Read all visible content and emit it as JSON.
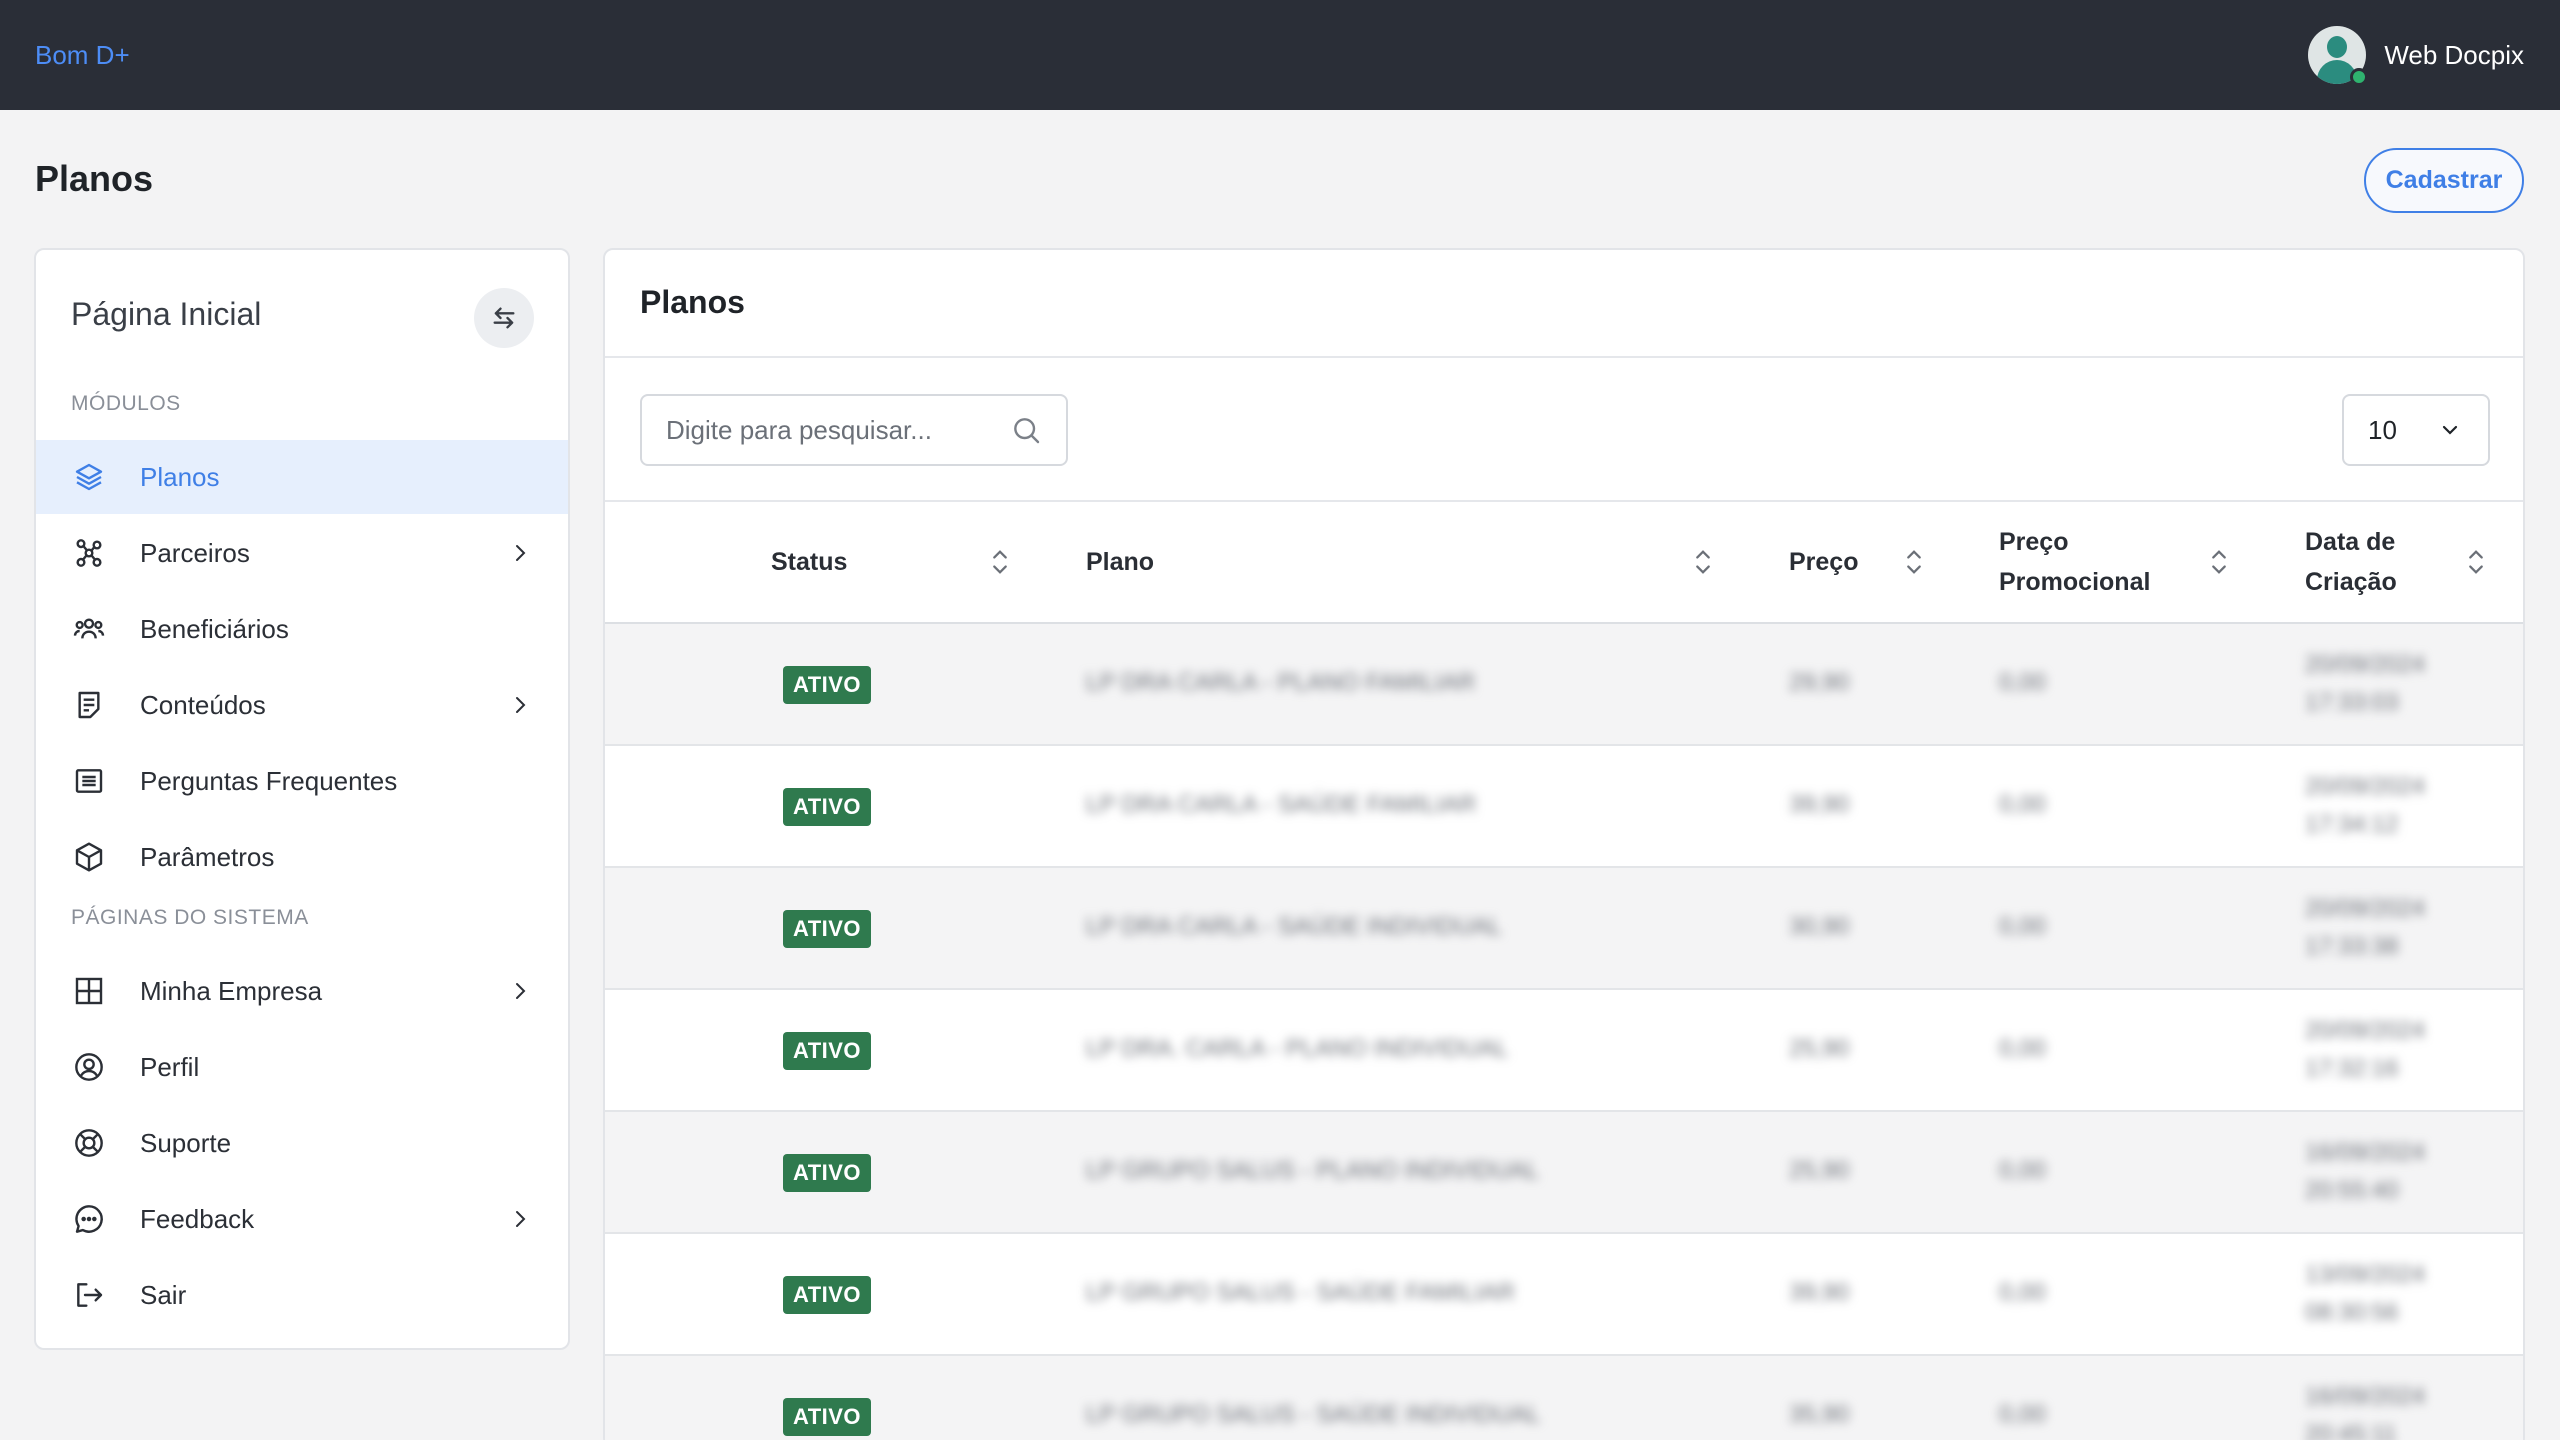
{
  "topbar": {
    "brand": "Bom D+",
    "user_name": "Web Docpix"
  },
  "header": {
    "title": "Planos",
    "cadastrar_label": "Cadastrar"
  },
  "sidebar": {
    "title": "Página Inicial",
    "section_modules": "MÓDULOS",
    "section_system": "PÁGINAS DO SISTEMA",
    "items": [
      {
        "label": "Planos",
        "icon": "layers-icon",
        "active": true
      },
      {
        "label": "Parceiros",
        "icon": "network-icon",
        "has_submenu": true
      },
      {
        "label": "Beneficiários",
        "icon": "users-icon"
      },
      {
        "label": "Conteúdos",
        "icon": "document-icon",
        "has_submenu": true
      },
      {
        "label": "Perguntas Frequentes",
        "icon": "list-icon"
      },
      {
        "label": "Parâmetros",
        "icon": "cube-icon"
      },
      {
        "label": "Minha Empresa",
        "icon": "grid-icon",
        "has_submenu": true
      },
      {
        "label": "Perfil",
        "icon": "user-circle-icon"
      },
      {
        "label": "Suporte",
        "icon": "lifebuoy-icon"
      },
      {
        "label": "Feedback",
        "icon": "chat-icon",
        "has_submenu": true
      },
      {
        "label": "Sair",
        "icon": "logout-icon"
      }
    ]
  },
  "main": {
    "title": "Planos",
    "search_placeholder": "Digite para pesquisar...",
    "per_page": "10",
    "columns": {
      "status": "Status",
      "plano": "Plano",
      "preco": "Preço",
      "preco_promo_1": "Preço",
      "preco_promo_2": "Promocional",
      "data_1": "Data de",
      "data_2": "Criação"
    },
    "rows": [
      {
        "status": "ATIVO",
        "plano": "LP DRA CARLA - PLANO FAMILIAR",
        "preco": "29,90",
        "promo": "0,00",
        "data": "20/09/2024",
        "hora": "17:33:03"
      },
      {
        "status": "ATIVO",
        "plano": "LP DRA CARLA - SAÚDE FAMILIAR",
        "preco": "39,90",
        "promo": "0,00",
        "data": "20/09/2024",
        "hora": "17:34:12"
      },
      {
        "status": "ATIVO",
        "plano": "LP DRA CARLA - SAÚDE INDIVIDUAL",
        "preco": "30,90",
        "promo": "0,00",
        "data": "20/09/2024",
        "hora": "17:33:38"
      },
      {
        "status": "ATIVO",
        "plano": "LP DRA. CARLA - PLANO INDIVIDUAL",
        "preco": "25,90",
        "promo": "0,00",
        "data": "20/09/2024",
        "hora": "17:32:16"
      },
      {
        "status": "ATIVO",
        "plano": "LP GRUPO SALUS - PLANO INDIVIDUAL",
        "preco": "25,90",
        "promo": "0,00",
        "data": "16/09/2024",
        "hora": "20:55:40"
      },
      {
        "status": "ATIVO",
        "plano": "LP GRUPO SALUS - SAÚDE FAMILIAR",
        "preco": "39,90",
        "promo": "0,00",
        "data": "13/09/2024",
        "hora": "08:30:56"
      },
      {
        "status": "ATIVO",
        "plano": "LP GRUPO SALUS - SAÚDE INDIVIDUAL",
        "preco": "35,90",
        "promo": "0,00",
        "data": "16/09/2024",
        "hora": "20:45:11"
      }
    ]
  }
}
